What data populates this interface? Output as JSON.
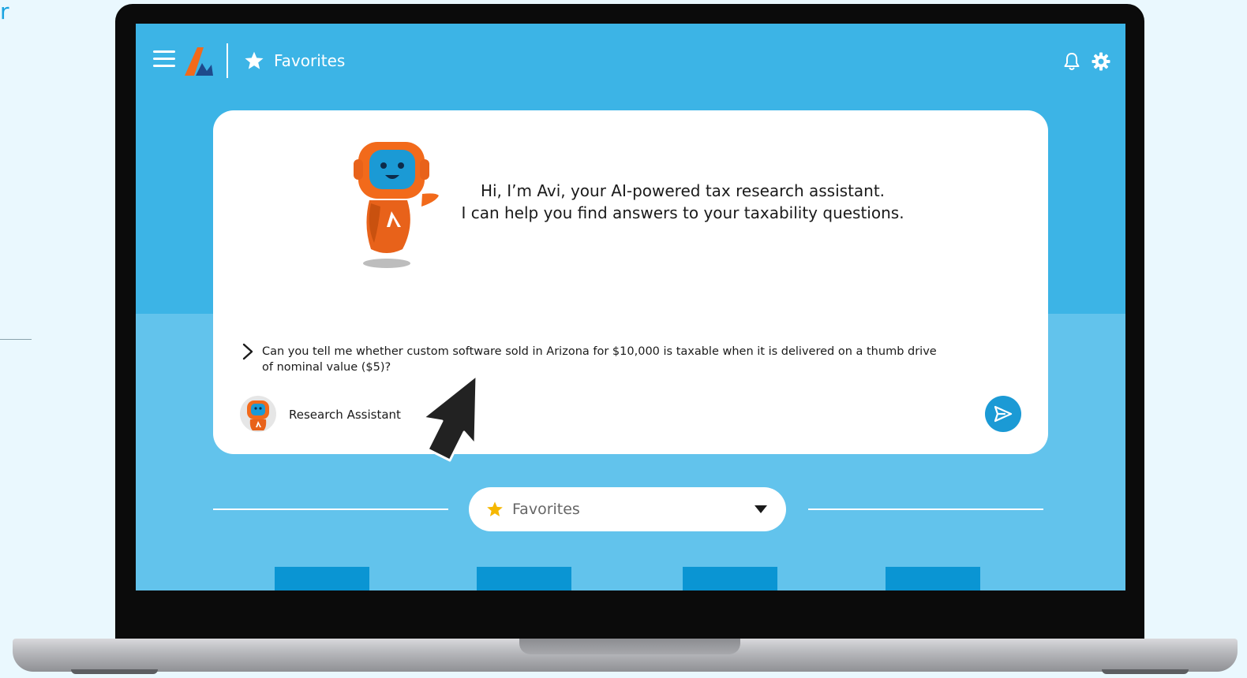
{
  "page": {
    "edge_glyph": "r"
  },
  "header": {
    "title": "Favorites",
    "icons": [
      "menu-icon",
      "logo-icon",
      "star-icon",
      "bell-icon",
      "gear-icon"
    ]
  },
  "chat": {
    "greeting_line1": "Hi, I’m Avi, your AI-powered tax research assistant.",
    "greeting_line2": "I can help you find answers to your taxability questions.",
    "prompt": "Can you tell me whether custom software sold in Arizona for $10,000 is taxable when it is delivered on a thumb drive of nominal value ($5)?",
    "assistant_name": "Research Assistant"
  },
  "favorites": {
    "selected": "Favorites"
  },
  "colors": {
    "screen_top": "#3cb4e6",
    "screen_bottom": "#62c3ec",
    "accent_orange": "#f26a1b",
    "send_blue": "#1b9ad5",
    "tile_blue": "#0a95d3",
    "star_yellow": "#f5b700"
  }
}
